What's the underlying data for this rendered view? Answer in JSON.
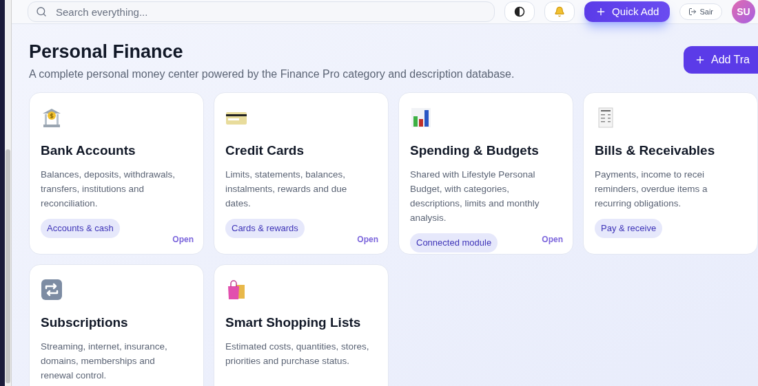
{
  "header": {
    "search": {
      "placeholder": "Search everything..."
    },
    "quick_add": "Quick Add",
    "logout": "Sair",
    "avatar": "SU"
  },
  "page": {
    "title": "Personal Finance",
    "subtitle": "A complete personal money center powered by the Finance Pro category and description database.",
    "add_button": "Add Tra"
  },
  "cards": [
    {
      "kind": "bank",
      "title": "Bank Accounts",
      "description_lines": [
        "Balances, deposits, withdrawals,",
        "transfers, institutions and",
        "reconciliation."
      ],
      "tag": "Accounts & cash",
      "link": "Open"
    },
    {
      "kind": "card",
      "title": "Credit Cards",
      "description_lines": [
        "Limits, statements, balances,",
        "instalments, rewards and due",
        "dates."
      ],
      "tag": "Cards & rewards",
      "link": "Open"
    },
    {
      "kind": "chart",
      "title": "Spending & Budgets",
      "description_lines": [
        "Shared with Lifestyle Personal",
        "Budget, with categories,",
        "descriptions, limits and monthly",
        "analysis."
      ],
      "tag": "Connected module",
      "link": "Open"
    },
    {
      "kind": "receipt",
      "title": "Bills & Receivables",
      "description_lines": [
        "Payments, income to recei",
        "reminders, overdue items a",
        "recurring obligations."
      ],
      "tag": "Pay & receive"
    },
    {
      "kind": "repeat",
      "title": "Subscriptions",
      "description_lines": [
        "Streaming, internet, insurance,",
        "domains, memberships and",
        "renewal control."
      ]
    },
    {
      "kind": "bag",
      "title": "Smart Shopping Lists",
      "description_lines": [
        "Estimated costs, quantities, stores,",
        "priorities and purchase status."
      ]
    }
  ]
}
